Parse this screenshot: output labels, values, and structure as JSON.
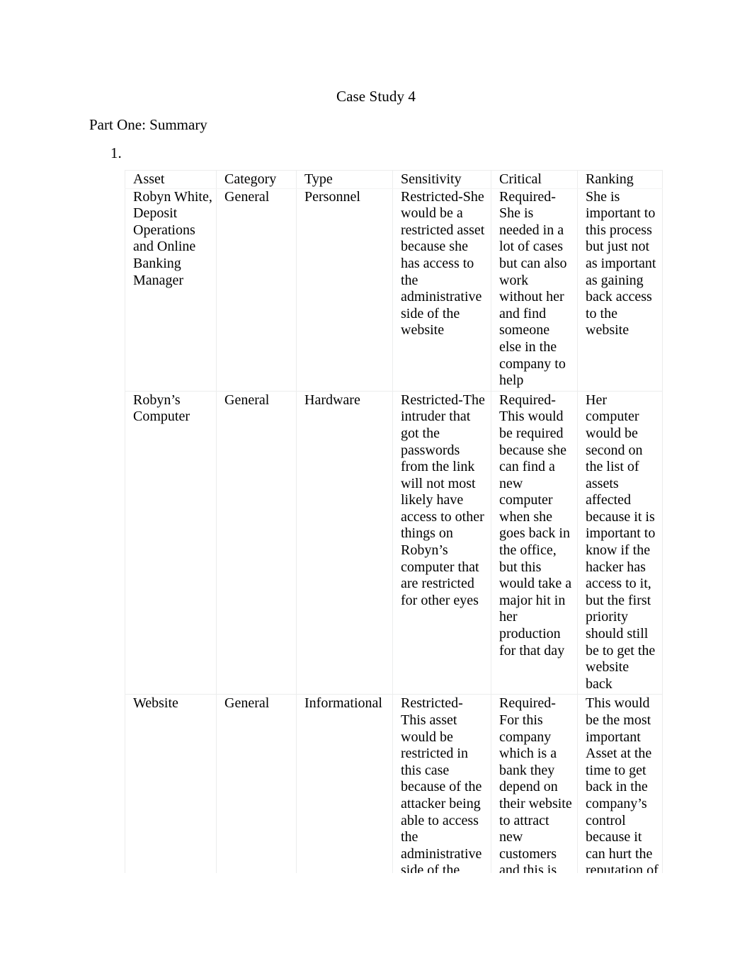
{
  "document": {
    "title": "Case Study 4",
    "section_heading": "Part One: Summary",
    "list_marker": "1."
  },
  "table": {
    "name": "asset-classification-table",
    "columns": [
      "Asset",
      "Category",
      "Type",
      "Sensitivity",
      "Critical",
      "Ranking"
    ],
    "rows": [
      {
        "asset": "Robyn White, Deposit Operations and Online Banking Manager",
        "category": "General",
        "type": "Personnel",
        "sensitivity": "Restricted-She would be a restricted asset because she has access to the administrative side of the website",
        "critical": "Required-She is needed in a lot of cases but can also work without her and find someone else in the company to help",
        "ranking": "She is important to this process but just not as important as gaining back access to the website"
      },
      {
        "asset": "Robyn’s Computer",
        "category": "General",
        "type": "Hardware",
        "sensitivity": "Restricted-The intruder that got the passwords from the link will not most likely have access to other things on Robyn’s computer that are restricted for other eyes",
        "critical": "Required-This would be required because she can find a new computer when she goes back in the office, but this would take a major hit in her production for that day",
        "ranking": "Her computer would be second on the list of assets affected because it is important to know if the hacker has access to it, but the first priority should still be to get the website back"
      },
      {
        "asset": "Website",
        "category": "General",
        "type": "Informational",
        "sensitivity": "Restricted-This asset would be restricted in this case because of the attacker being able to access the administrative side of the website",
        "critical": "Required-For this company which is a bank they depend on their website to attract new customers and this is where they conduct most of their business",
        "ranking": "This would be the most important Asset at the time to get back in the company’s control because it can hurt the reputation of the company"
      }
    ]
  },
  "colors": {
    "page_background": "#ffffff",
    "text": "#000000",
    "table_border": "#eceded"
  }
}
